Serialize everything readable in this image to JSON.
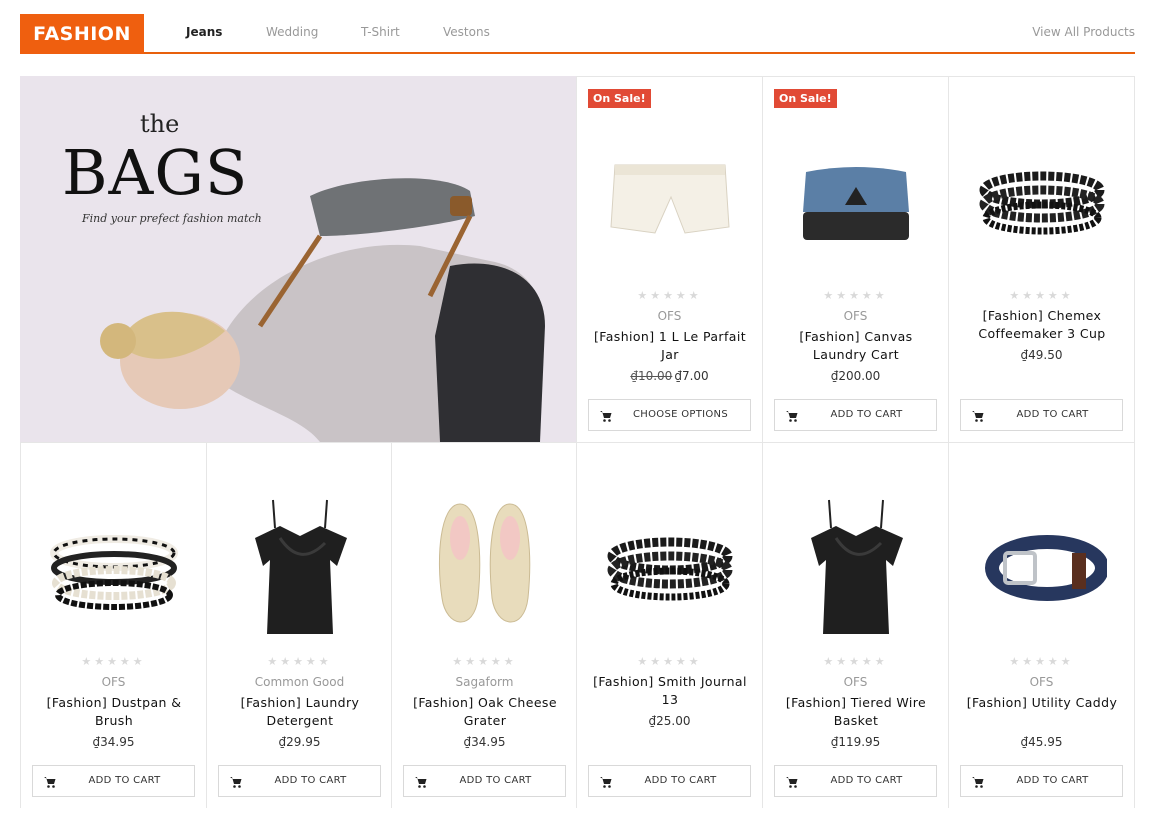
{
  "header": {
    "brand": "FASHION",
    "tabs": [
      {
        "label": "Jeans",
        "active": true
      },
      {
        "label": "Wedding",
        "active": false
      },
      {
        "label": "T-Shirt",
        "active": false
      },
      {
        "label": "Vestons",
        "active": false
      }
    ],
    "view_all": "View All Products"
  },
  "banner": {
    "the": "the",
    "title": "BAGS",
    "tagline": "Find your prefect fashion match"
  },
  "products": [
    {
      "sale_badge": "On Sale!",
      "vendor": "OFS",
      "name": "[Fashion] 1 L Le Parfait Jar",
      "old_price": "₫10.00",
      "price": "₫7.00",
      "button": "CHOOSE OPTIONS",
      "image": "white-shorts"
    },
    {
      "sale_badge": "On Sale!",
      "vendor": "OFS",
      "name": "[Fashion] Canvas Laundry Cart",
      "old_price": "",
      "price": "₫200.00",
      "button": "ADD TO CART",
      "image": "denim-pouch"
    },
    {
      "sale_badge": "",
      "vendor": "",
      "name": "[Fashion] Chemex Coffeemaker 3 Cup",
      "old_price": "",
      "price": "₫49.50",
      "button": "ADD TO CART",
      "image": "bead-bracelets"
    },
    {
      "sale_badge": "",
      "vendor": "OFS",
      "name": "[Fashion] Dustpan & Brush",
      "old_price": "",
      "price": "₫34.95",
      "button": "ADD TO CART",
      "image": "woven-bracelets"
    },
    {
      "sale_badge": "",
      "vendor": "Common Good",
      "name": "[Fashion] Laundry Detergent",
      "old_price": "",
      "price": "₫29.95",
      "button": "ADD TO CART",
      "image": "black-top"
    },
    {
      "sale_badge": "",
      "vendor": "Sagaform",
      "name": "[Fashion] Oak Cheese Grater",
      "old_price": "",
      "price": "₫34.95",
      "button": "ADD TO CART",
      "image": "ballet-flats"
    },
    {
      "sale_badge": "",
      "vendor": "",
      "name": "[Fashion] Smith Journal 13",
      "old_price": "",
      "price": "₫25.00",
      "button": "ADD TO CART",
      "image": "bead-bracelets"
    },
    {
      "sale_badge": "",
      "vendor": "OFS",
      "name": "[Fashion] Tiered Wire Basket",
      "old_price": "",
      "price": "₫119.95",
      "button": "ADD TO CART",
      "image": "black-top"
    },
    {
      "sale_badge": "",
      "vendor": "OFS",
      "name": "[Fashion] Utility Caddy",
      "old_price": "",
      "price": "₫45.95",
      "button": "ADD TO CART",
      "image": "blue-belt"
    }
  ],
  "stars": "★★★★★",
  "colors": {
    "accent": "#ef5f0f",
    "sale": "#e14a35"
  }
}
